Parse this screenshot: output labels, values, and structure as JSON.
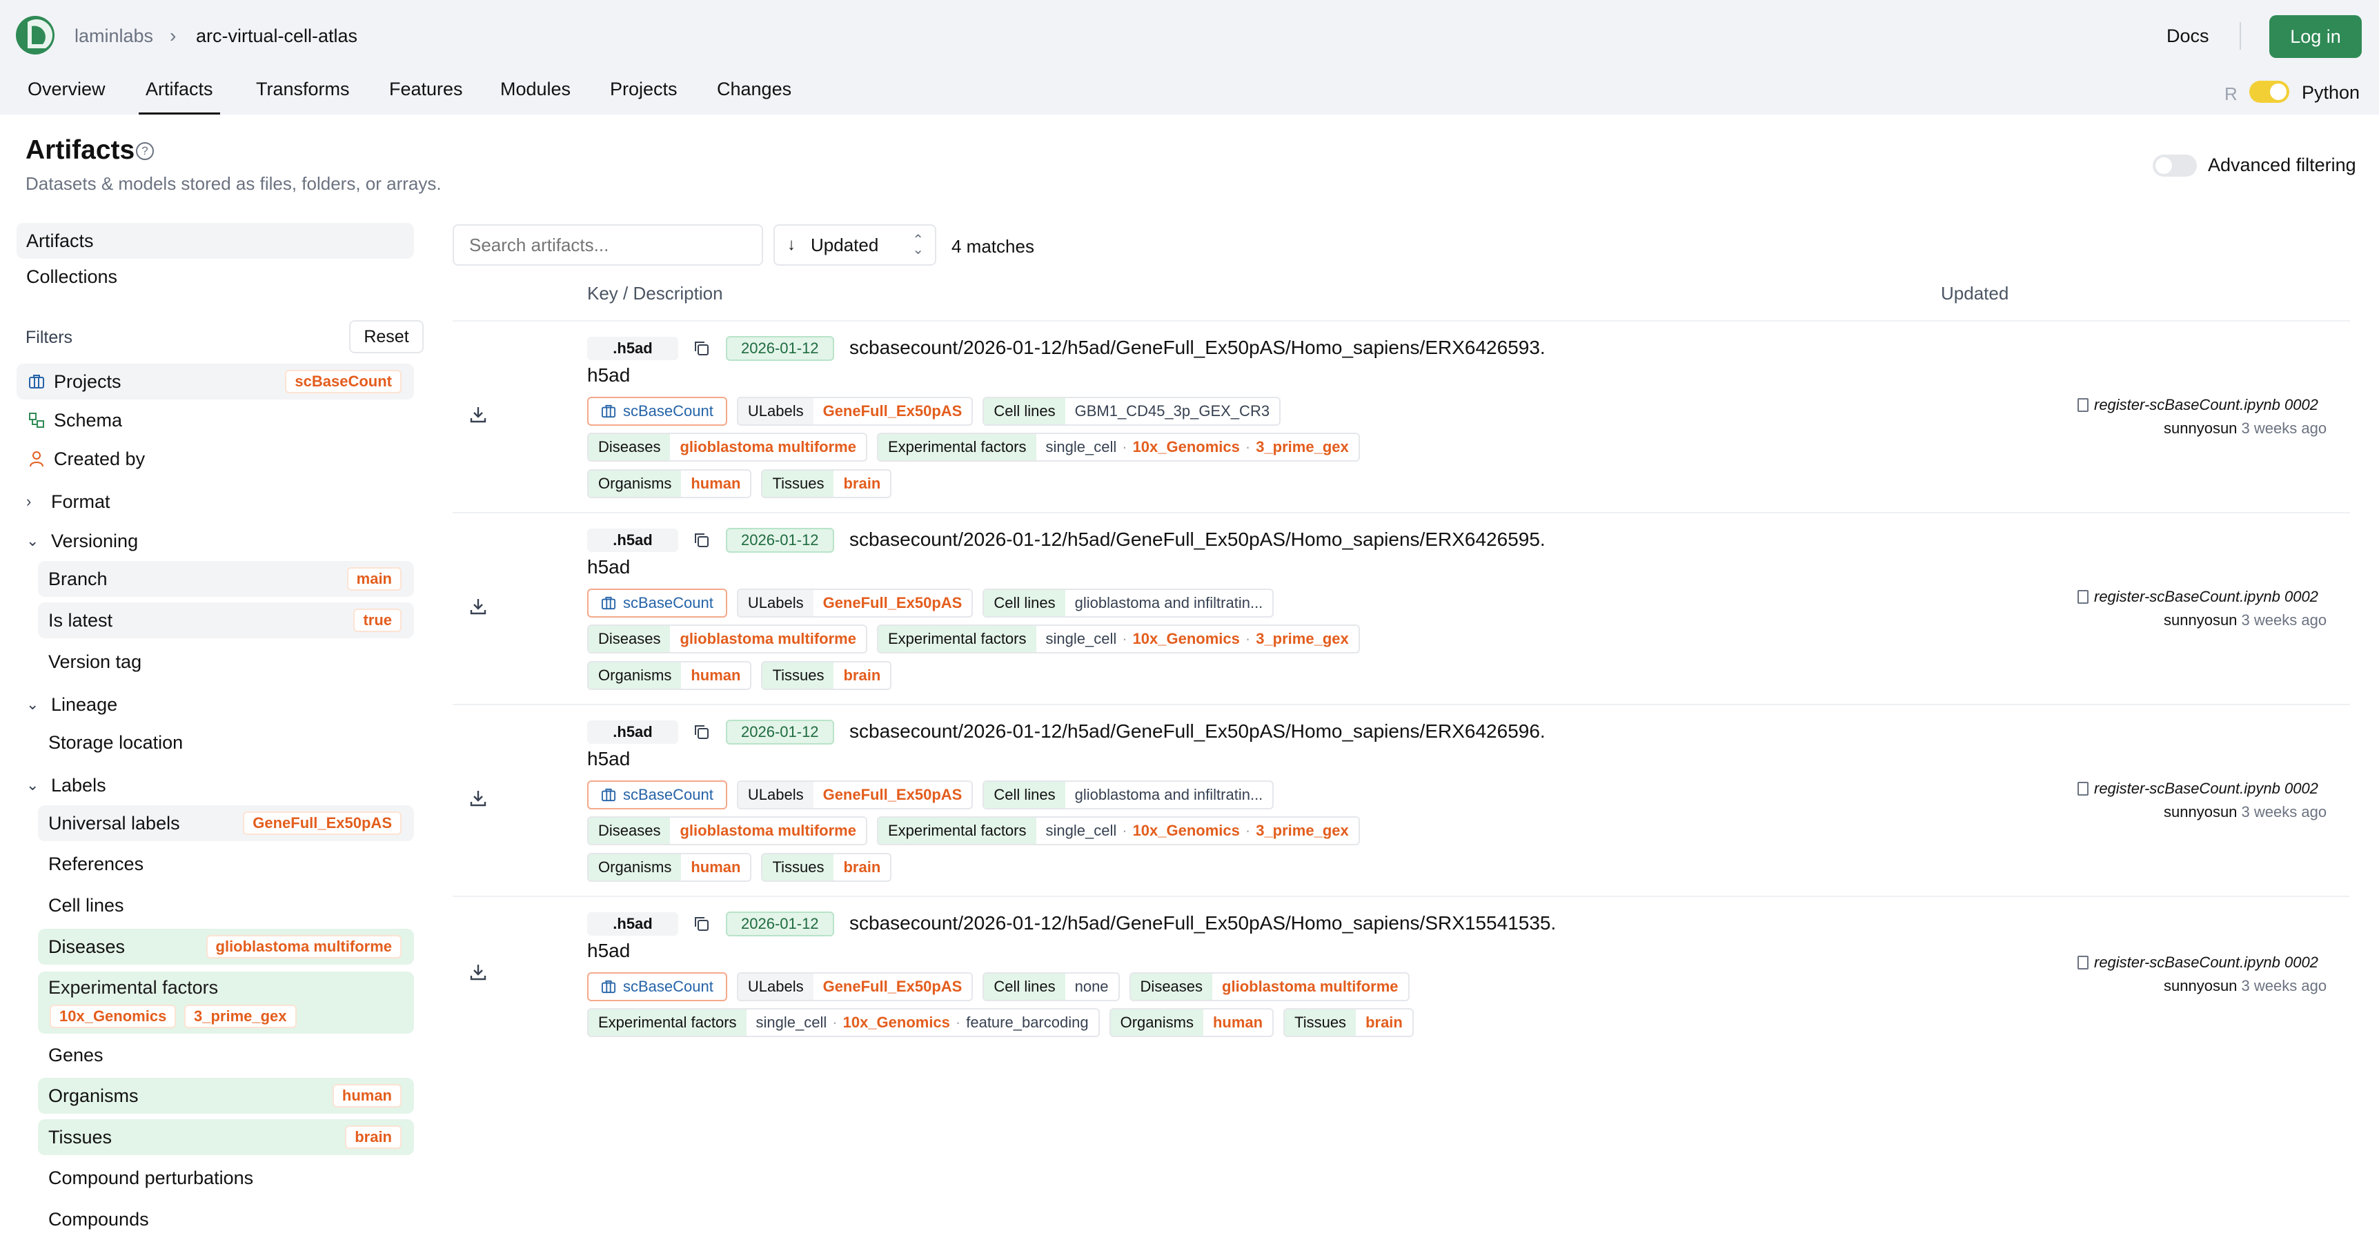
{
  "header": {
    "org": "laminlabs",
    "breadcrumb_sep": "›",
    "instance": "arc-virtual-cell-atlas",
    "docs": "Docs",
    "login": "Log in",
    "tabs": [
      "Overview",
      "Artifacts",
      "Transforms",
      "Features",
      "Modules",
      "Projects",
      "Changes"
    ],
    "active_tab": "Artifacts",
    "lang_r": "R",
    "lang_python": "Python",
    "accent": "#2f8a55"
  },
  "page": {
    "title": "Artifacts",
    "subtitle": "Datasets & models stored as files, folders, or arrays.",
    "advanced_filtering": "Advanced filtering"
  },
  "sidebar": {
    "artifacts": "Artifacts",
    "collections": "Collections",
    "filters": "Filters",
    "reset": "Reset",
    "projects": "Projects",
    "projects_value": "scBaseCount",
    "schema": "Schema",
    "created_by": "Created by",
    "format": "Format",
    "versioning": "Versioning",
    "branch": "Branch",
    "branch_value": "main",
    "is_latest": "Is latest",
    "is_latest_value": "true",
    "version_tag": "Version tag",
    "lineage": "Lineage",
    "storage_location": "Storage location",
    "labels": "Labels",
    "universal_labels": "Universal labels",
    "universal_labels_value": "GeneFull_Ex50pAS",
    "references": "References",
    "cell_lines": "Cell lines",
    "diseases": "Diseases",
    "diseases_value": "glioblastoma multiforme",
    "experimental_factors": "Experimental factors",
    "exp_value_1": "10x_Genomics",
    "exp_value_2": "3_prime_gex",
    "genes": "Genes",
    "organisms": "Organisms",
    "organisms_value": "human",
    "tissues": "Tissues",
    "tissues_value": "brain",
    "compound_perturbations": "Compound perturbations",
    "compounds": "Compounds"
  },
  "toolbar": {
    "search_placeholder": "Search artifacts...",
    "sort": "Updated",
    "matches": "4 matches"
  },
  "table": {
    "col_key": "Key / Description",
    "col_updated": "Updated"
  },
  "labels": {
    "ulabels": "ULabels",
    "cell_lines": "Cell lines",
    "diseases": "Diseases",
    "experimental_factors": "Experimental factors",
    "organisms": "Organisms",
    "tissues": "Tissues",
    "project": "scBaseCount",
    "ulabel_value": "GeneFull_Ex50pAS",
    "disease_value": "glioblastoma multiforme",
    "organism_value": "human",
    "tissue_value": "brain",
    "ef_single_cell": "single_cell",
    "ef_10x": "10x_Genomics",
    "ef_3prime": "3_prime_gex",
    "ef_feature_barcoding": "feature_barcoding",
    "dot": "·"
  },
  "rows": [
    {
      "ext": ".h5ad",
      "date": "2026-01-12",
      "key": "scbasecount/2026-01-12/h5ad/GeneFull_Ex50pAS/Homo_sapiens/ERX6426593.",
      "key_tail": "h5ad",
      "cell_line": "GBM1_CD45_3p_GEX_CR3",
      "notebook": "register-scBaseCount.ipynb",
      "version": "0002",
      "user": "sunnyosun",
      "ago": "3 weeks ago"
    },
    {
      "ext": ".h5ad",
      "date": "2026-01-12",
      "key": "scbasecount/2026-01-12/h5ad/GeneFull_Ex50pAS/Homo_sapiens/ERX6426595.",
      "key_tail": "h5ad",
      "cell_line": "glioblastoma and infiltratin...",
      "notebook": "register-scBaseCount.ipynb",
      "version": "0002",
      "user": "sunnyosun",
      "ago": "3 weeks ago"
    },
    {
      "ext": ".h5ad",
      "date": "2026-01-12",
      "key": "scbasecount/2026-01-12/h5ad/GeneFull_Ex50pAS/Homo_sapiens/ERX6426596.",
      "key_tail": "h5ad",
      "cell_line": "glioblastoma and infiltratin...",
      "notebook": "register-scBaseCount.ipynb",
      "version": "0002",
      "user": "sunnyosun",
      "ago": "3 weeks ago"
    },
    {
      "ext": ".h5ad",
      "date": "2026-01-12",
      "key": "scbasecount/2026-01-12/h5ad/GeneFull_Ex50pAS/Homo_sapiens/SRX15541535.",
      "key_tail": "h5ad",
      "cell_line": "none",
      "notebook": "register-scBaseCount.ipynb",
      "version": "0002",
      "user": "sunnyosun",
      "ago": "3 weeks ago"
    }
  ]
}
